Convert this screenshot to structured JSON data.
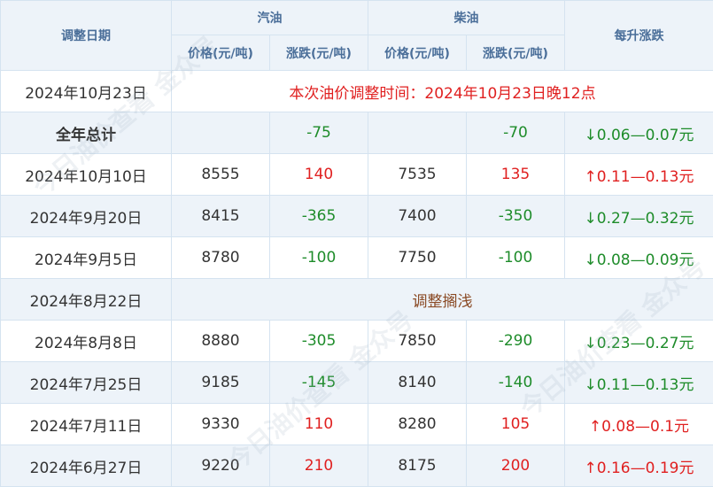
{
  "header": {
    "date_col": "调整日期",
    "gasoline": "汽油",
    "diesel": "柴油",
    "per_liter": "每升涨跌",
    "price": "价格(元/吨)",
    "change": "涨跌(元/吨)"
  },
  "rows": [
    {
      "date": "2024年10月23日",
      "notice": "本次油价调整时间：2024年10月23日晚12点"
    },
    {
      "date": "全年总计",
      "g_price": "",
      "g_change": "-75",
      "d_price": "",
      "d_change": "-70",
      "per_liter": "↓0.06—0.07元"
    },
    {
      "date": "2024年10月10日",
      "g_price": "8555",
      "g_change": "140",
      "d_price": "7535",
      "d_change": "135",
      "per_liter": "↑0.11—0.13元"
    },
    {
      "date": "2024年9月20日",
      "g_price": "8415",
      "g_change": "-365",
      "d_price": "7400",
      "d_change": "-350",
      "per_liter": "↓0.27—0.32元"
    },
    {
      "date": "2024年9月5日",
      "g_price": "8780",
      "g_change": "-100",
      "d_price": "7750",
      "d_change": "-100",
      "per_liter": "↓0.08—0.09元"
    },
    {
      "date": "2024年8月22日",
      "notice": "调整搁浅"
    },
    {
      "date": "2024年8月8日",
      "g_price": "8880",
      "g_change": "-305",
      "d_price": "7850",
      "d_change": "-290",
      "per_liter": "↓0.23—0.27元"
    },
    {
      "date": "2024年7月25日",
      "g_price": "9185",
      "g_change": "-145",
      "d_price": "8140",
      "d_change": "-140",
      "per_liter": "↓0.11—0.13元"
    },
    {
      "date": "2024年7月11日",
      "g_price": "9330",
      "g_change": "110",
      "d_price": "8280",
      "d_change": "105",
      "per_liter": "↑0.08—0.1元"
    },
    {
      "date": "2024年6月27日",
      "g_price": "9220",
      "g_change": "210",
      "d_price": "8175",
      "d_change": "200",
      "per_liter": "↑0.16—0.19元"
    }
  ],
  "watermark": "今日油价查看 金众号",
  "colors": {
    "up": "#e02020",
    "down": "#1e8c2a",
    "header_text": "#4a6e99",
    "header_bg": "#edf3f9",
    "border": "#d5e3f0"
  }
}
